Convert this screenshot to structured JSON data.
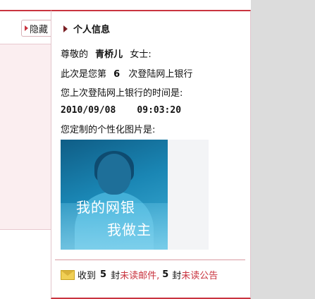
{
  "hide_tab": {
    "label": "隐藏"
  },
  "title": "个人信息",
  "greeting": {
    "prefix": "尊敬的",
    "name": "青桥儿",
    "suffix": "女士:"
  },
  "login_count": {
    "prefix": "此次是您第",
    "count": "6",
    "suffix": "次登陆网上银行"
  },
  "last_login_label": "您上次登陆网上银行的时间是:",
  "last_login_date": "2010/09/08",
  "last_login_time": "09:03:20",
  "picture_label": "您定制的个性化图片是:",
  "picture": {
    "line1": "我的网银",
    "line2": "我做主"
  },
  "messages": {
    "received": "收到",
    "mail_count": "5",
    "unit": "封",
    "mail_link": "未读邮件,",
    "notice_count": "5",
    "notice_link": "未读公告"
  },
  "colors": {
    "accent": "#c9343f",
    "panel_bg": "#ffffff",
    "side_bg": "#dcdcdc"
  }
}
